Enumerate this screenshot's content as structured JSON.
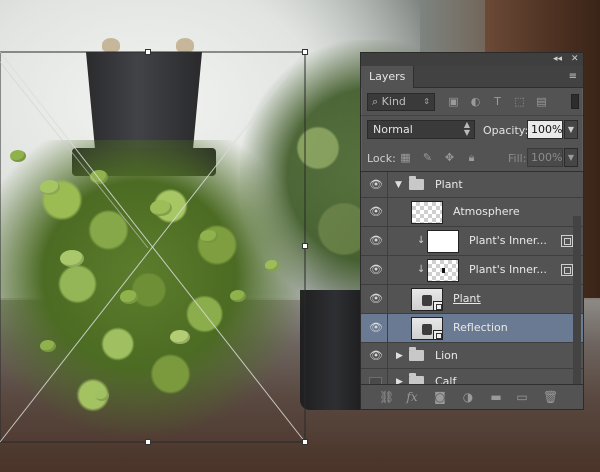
{
  "panel": {
    "collapse_glyph": "◂◂",
    "close_glyph": "✕",
    "tab_title": "Layers",
    "menu_glyph": "≡"
  },
  "filter": {
    "kind_label": "Kind",
    "search_glyph": "⌕",
    "icons": [
      "image-filter-icon",
      "adjustment-filter-icon",
      "type-filter-icon",
      "shape-filter-icon",
      "smart-object-filter-icon"
    ]
  },
  "blend": {
    "mode": "Normal",
    "opacity_label": "Opacity:",
    "opacity_value": "100%",
    "lock_label": "Lock:",
    "fill_label": "Fill:",
    "fill_value": "100%"
  },
  "layers": [
    {
      "name": "Plant",
      "type": "group",
      "visible": true,
      "expanded": true
    },
    {
      "name": "Atmosphere",
      "type": "layer",
      "visible": true,
      "thumb": "transparent"
    },
    {
      "name": "Plant's Inner...",
      "type": "layer",
      "visible": true,
      "clipped": true,
      "thumb": "white"
    },
    {
      "name": "Plant's Inner...",
      "type": "layer",
      "visible": true,
      "clipped": true,
      "thumb": "transparent-dot"
    },
    {
      "name": "Plant",
      "type": "smart-object",
      "visible": true,
      "underlined": true
    },
    {
      "name": "Reflection",
      "type": "smart-object",
      "visible": true,
      "selected": true
    },
    {
      "name": "Lion",
      "type": "group",
      "visible": true,
      "expanded": false
    },
    {
      "name": "Calf",
      "type": "group",
      "visible": false,
      "expanded": false
    }
  ],
  "bottom_icons": [
    "link-icon",
    "fx-icon",
    "mask-icon",
    "adjustment-icon",
    "new-group-icon",
    "new-layer-icon",
    "trash-icon"
  ],
  "colors": {
    "panel_bg": "#535353",
    "selected_row": "#6a7a93"
  }
}
